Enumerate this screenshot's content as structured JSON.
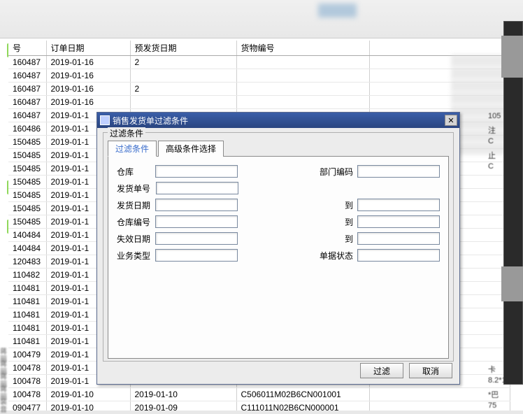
{
  "columns": [
    "号",
    "订单日期",
    "预发货日期",
    "货物编号"
  ],
  "rows": [
    {
      "id": "160487",
      "od": "2019-01-16",
      "pd": "2",
      "gc": ""
    },
    {
      "id": "160487",
      "od": "2019-01-16",
      "pd": "",
      "gc": ""
    },
    {
      "id": "160487",
      "od": "2019-01-16",
      "pd": "2",
      "gc": ""
    },
    {
      "id": "160487",
      "od": "2019-01-16",
      "pd": "",
      "gc": ""
    },
    {
      "id": "160487",
      "od": "2019-01-1",
      "pd": "",
      "gc": ""
    },
    {
      "id": "160486",
      "od": "2019-01-1",
      "pd": "",
      "gc": ""
    },
    {
      "id": "150485",
      "od": "2019-01-1",
      "pd": "",
      "gc": ""
    },
    {
      "id": "150485",
      "od": "2019-01-1",
      "pd": "",
      "gc": ""
    },
    {
      "id": "150485",
      "od": "2019-01-1",
      "pd": "",
      "gc": ""
    },
    {
      "id": "150485",
      "od": "2019-01-1",
      "pd": "",
      "gc": ""
    },
    {
      "id": "150485",
      "od": "2019-01-1",
      "pd": "",
      "gc": ""
    },
    {
      "id": "150485",
      "od": "2019-01-1",
      "pd": "",
      "gc": ""
    },
    {
      "id": "150485",
      "od": "2019-01-1",
      "pd": "",
      "gc": ""
    },
    {
      "id": "140484",
      "od": "2019-01-1",
      "pd": "",
      "gc": ""
    },
    {
      "id": "140484",
      "od": "2019-01-1",
      "pd": "",
      "gc": ""
    },
    {
      "id": "120483",
      "od": "2019-01-1",
      "pd": "",
      "gc": ""
    },
    {
      "id": "110482",
      "od": "2019-01-1",
      "pd": "",
      "gc": ""
    },
    {
      "id": "110481",
      "od": "2019-01-1",
      "pd": "",
      "gc": ""
    },
    {
      "id": "110481",
      "od": "2019-01-1",
      "pd": "",
      "gc": ""
    },
    {
      "id": "110481",
      "od": "2019-01-1",
      "pd": "",
      "gc": ""
    },
    {
      "id": "110481",
      "od": "2019-01-1",
      "pd": "",
      "gc": ""
    },
    {
      "id": "110481",
      "od": "2019-01-1",
      "pd": "",
      "gc": ""
    },
    {
      "id": "100479",
      "od": "2019-01-1",
      "pd": "",
      "gc": ""
    },
    {
      "id": "100478",
      "od": "2019-01-1",
      "pd": "",
      "gc": ""
    },
    {
      "id": "100478",
      "od": "2019-01-1",
      "pd": "",
      "gc": ""
    },
    {
      "id": "100478",
      "od": "2019-01-10",
      "pd": "2019-01-10",
      "gc": "C506011M02B6CN001001"
    },
    {
      "id": "090477",
      "od": "2019-01-10",
      "pd": "2019-01-09",
      "gc": "C111011N02B6CN000001"
    }
  ],
  "side_smudge": [
    "蒋丽",
    "蒋丽",
    "蒋丽",
    "蒋丽",
    "装音"
  ],
  "right_hints": [
    "105",
    "注",
    "C",
    "止",
    "C",
    "",
    "",
    "",
    "",
    "",
    "",
    "",
    "",
    "",
    "",
    "",
    "",
    "",
    "",
    "",
    "卡",
    "8.2*1",
    "*巴",
    "75"
  ],
  "dialog": {
    "title": "销售发货单过滤条件",
    "group_label": "过滤条件",
    "tabs": [
      "过滤条件",
      "高级条件选择"
    ],
    "labels": {
      "warehouse": "仓库",
      "dept_no": "部门编码",
      "ship_no": "发货单号",
      "ship_date": "发货日期",
      "to": "到",
      "wh_no": "仓库编号",
      "expire": "失效日期",
      "biz_type": "业务类型",
      "doc_status": "单据状态"
    },
    "buttons": {
      "filter": "过滤",
      "cancel": "取消"
    }
  }
}
